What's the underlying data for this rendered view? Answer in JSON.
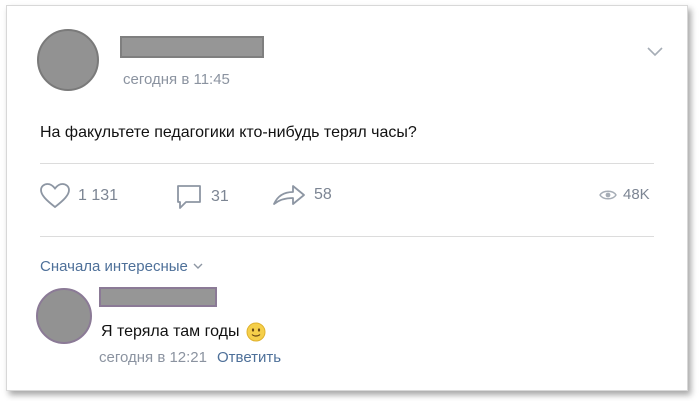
{
  "post": {
    "time": "сегодня в 11:45",
    "text": "На факультете педагогики кто-нибудь терял часы?",
    "stats": {
      "likes": "1 131",
      "comments": "31",
      "shares": "58",
      "views": "48K"
    }
  },
  "comments_section": {
    "sort_label": "Сначала интересные",
    "items": [
      {
        "text": "Я теряла там годы",
        "time": "сегодня в 12:21",
        "reply_label": "Ответить",
        "emoji": "slightly-smiling-emoji"
      }
    ]
  },
  "colors": {
    "link": "#4e7099",
    "muted": "#8b93a0",
    "redaction": "#969696"
  }
}
